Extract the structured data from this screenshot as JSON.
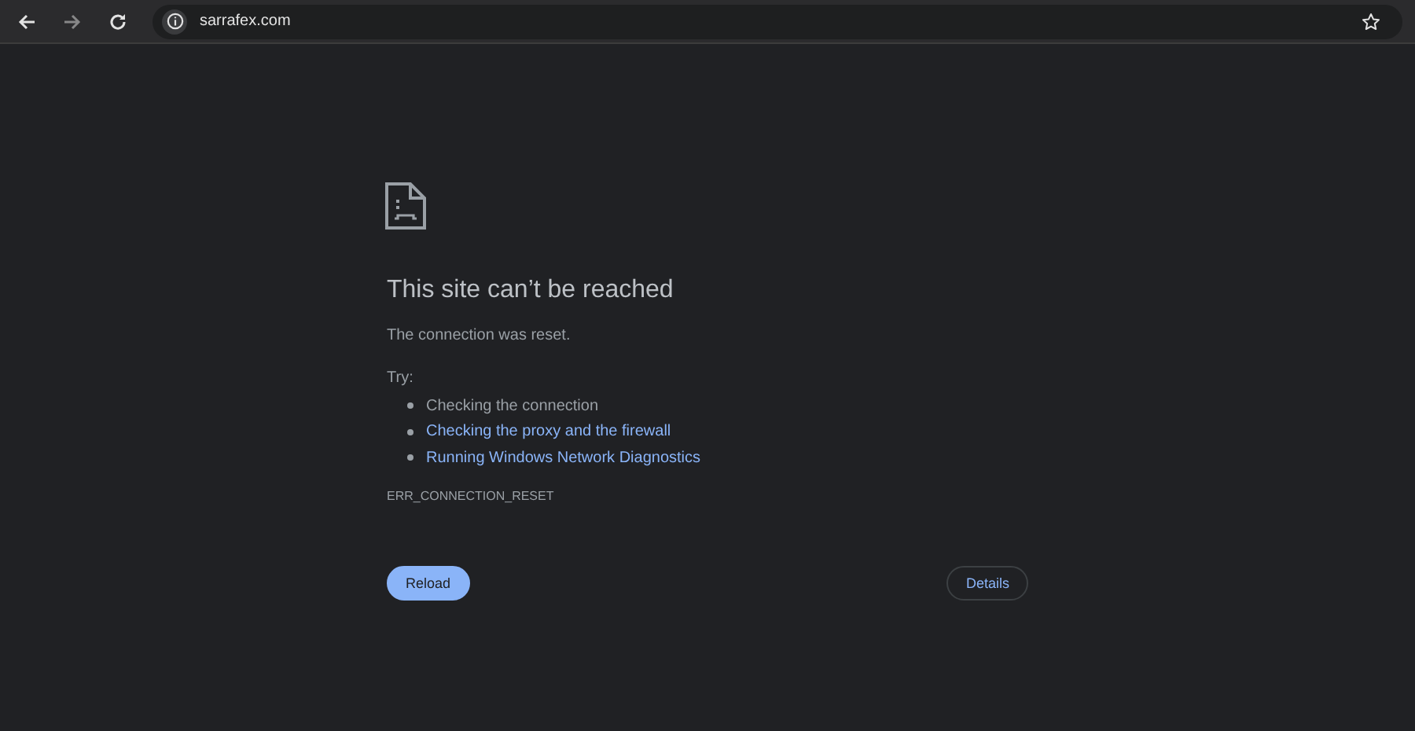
{
  "toolbar": {
    "back_disabled": false,
    "forward_disabled": true,
    "url": "sarrafex.com",
    "bookmarked": false
  },
  "error": {
    "title": "This site can’t be reached",
    "message": "The connection was reset.",
    "try_label": "Try:",
    "suggestions": [
      {
        "kind": "text",
        "label": "Checking the connection"
      },
      {
        "kind": "link",
        "label": "Checking the proxy and the firewall"
      },
      {
        "kind": "link",
        "label": "Running Windows Network Diagnostics"
      }
    ],
    "code": "ERR_CONNECTION_RESET"
  },
  "buttons": [
    {
      "kind": "primary",
      "label": "Reload"
    },
    {
      "kind": "secondary",
      "label": "Details"
    }
  ]
}
